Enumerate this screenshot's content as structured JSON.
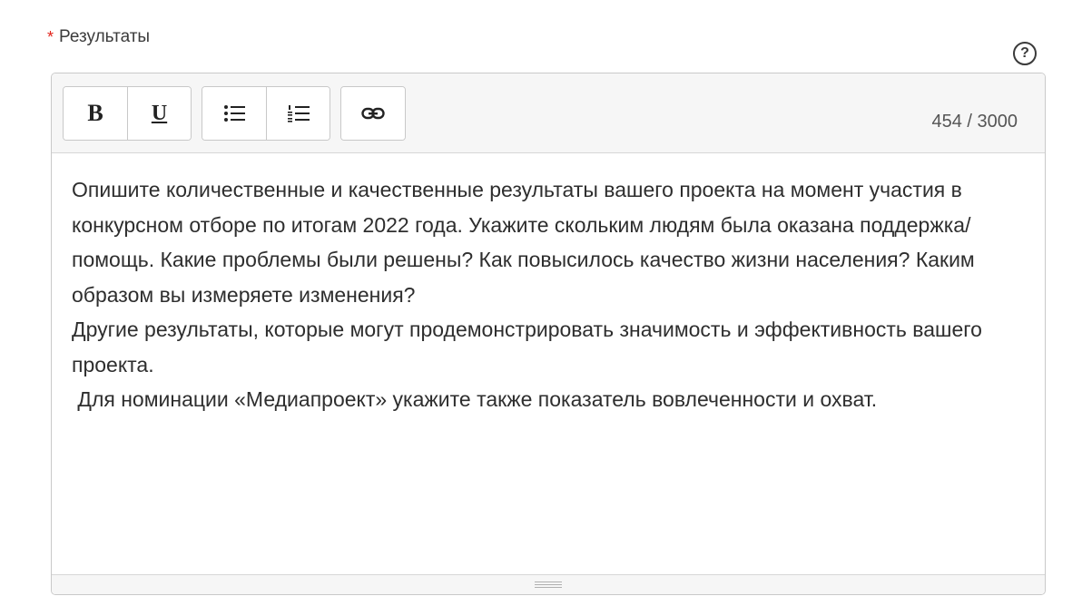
{
  "field": {
    "required_mark": "*",
    "label": "Результаты",
    "help_symbol": "?"
  },
  "toolbar": {
    "bold_label": "B",
    "underline_label": "U",
    "bullet_list_icon": "bullet-list-icon",
    "numbered_list_icon": "numbered-list-icon",
    "link_icon": "link-icon"
  },
  "counter": {
    "text": "454 / 3000"
  },
  "content": {
    "paragraphs": [
      "Опишите количественные и качественные результаты вашего проекта на момент участия в конкурсном отборе по итогам 2022 года. Укажите скольким людям была оказана поддержка/помощь. Какие проблемы были решены? Как повысилось качество жизни населения? Каким образом вы измеряете изменения?",
      "Другие результаты, которые могут продемонстрировать значимость и эффективность вашего проекта.",
      " Для номинации «Медиапроект» укажите также показатель вовлеченности и охват."
    ]
  },
  "colors": {
    "required": "#e2231a",
    "toolbar_bg": "#f6f6f6",
    "border": "#c9c9c9",
    "text": "#2e2e2e"
  }
}
